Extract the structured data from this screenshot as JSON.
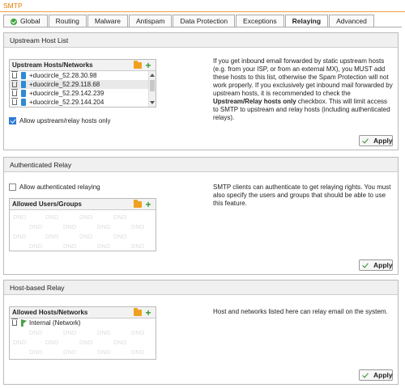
{
  "page_title": "SMTP",
  "tabs": [
    {
      "label": "Global",
      "status": "ok"
    },
    {
      "label": "Routing"
    },
    {
      "label": "Malware"
    },
    {
      "label": "Antispam"
    },
    {
      "label": "Data Protection"
    },
    {
      "label": "Exceptions"
    },
    {
      "label": "Relaying",
      "active": true
    },
    {
      "label": "Advanced"
    }
  ],
  "upstream": {
    "title": "Upstream Host List",
    "list_header": "Upstream Hosts/Networks",
    "items": [
      "+duocircle_52.28.30.98",
      "+duocircle_52.29.118.68",
      "+duocircle_52.29.142.239",
      "+duocircle_52.29.144.204"
    ],
    "checkbox_label": "Allow upstream/relay hosts only",
    "checkbox_checked": true,
    "desc_1": "If you get inbound email forwarded by static upstream hosts (e.g. from your ISP, or from an external MX), you MUST add these hosts to this list, otherwise the Spam Protection will not work properly. If you exclusively get inbound mail forwarded by upstream hosts, it is recommended to check the ",
    "desc_bold": "Upstream/Relay hosts only",
    "desc_2": " checkbox. This will limit access to SMTP to upstream and relay hosts (including authenticated relays).",
    "apply_label": "Apply"
  },
  "auth_relay": {
    "title": "Authenticated Relay",
    "checkbox_label": "Allow authenticated relaying",
    "checkbox_checked": false,
    "list_header": "Allowed Users/Groups",
    "placeholder": "DND",
    "desc": "SMTP clients can authenticate to get relaying rights. You must also specify the users and groups that should be able to use this feature.",
    "apply_label": "Apply"
  },
  "host_relay": {
    "title": "Host-based Relay",
    "list_header": "Allowed Hosts/Networks",
    "items": [
      "Internal (Network)"
    ],
    "placeholder": "DND",
    "desc": "Host and networks listed here can relay email on the system.",
    "apply_label": "Apply"
  },
  "colors": {
    "accent": "#e07b00",
    "ok": "#3aa53a",
    "host_icon": "#2e8ad6"
  }
}
